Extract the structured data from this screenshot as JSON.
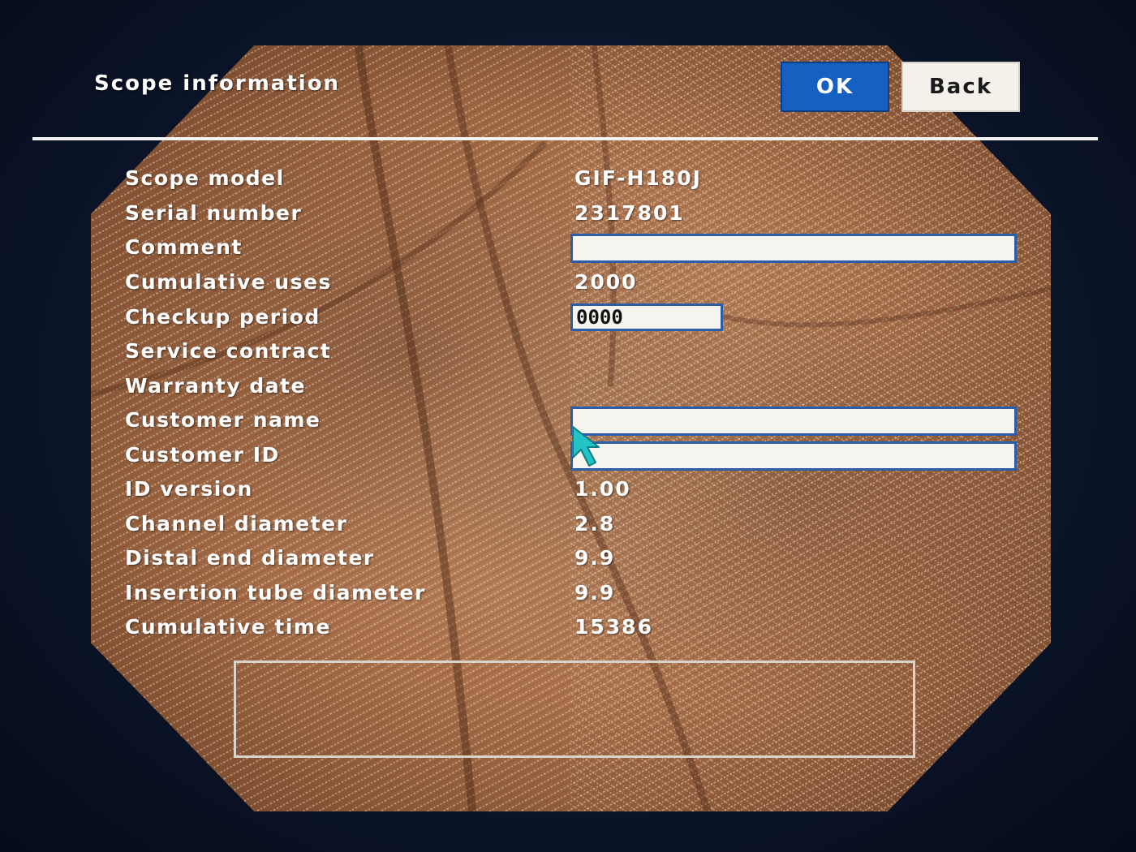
{
  "header": {
    "title": "Scope information",
    "ok_label": "OK",
    "back_label": "Back"
  },
  "fields": {
    "scope_model": {
      "label": "Scope model",
      "value": "GIF-H180J"
    },
    "serial_number": {
      "label": "Serial number",
      "value": "2317801"
    },
    "comment": {
      "label": "Comment",
      "value": ""
    },
    "cumulative_uses": {
      "label": "Cumulative uses",
      "value": "2000"
    },
    "checkup_period": {
      "label": "Checkup period",
      "value": "0000"
    },
    "service_contract": {
      "label": "Service contract"
    },
    "warranty_date": {
      "label": "Warranty date"
    },
    "customer_name": {
      "label": "Customer name",
      "value": ""
    },
    "customer_id": {
      "label": "Customer ID",
      "value": ""
    },
    "id_version": {
      "label": "ID version",
      "value": "1.00"
    },
    "channel_diameter": {
      "label": "Channel diameter",
      "value": "2.8"
    },
    "distal_end_diameter": {
      "label": "Distal end diameter",
      "value": "9.9"
    },
    "insertion_tube_diameter": {
      "label": "Insertion tube diameter",
      "value": "9.9"
    },
    "cumulative_time": {
      "label": "Cumulative time",
      "value": "15386"
    }
  },
  "colors": {
    "ok_button": "#1560c0",
    "field_border": "#2c5da8",
    "cursor": "#22c4c8"
  },
  "icons": {
    "cursor": "mouse-pointer-icon"
  }
}
